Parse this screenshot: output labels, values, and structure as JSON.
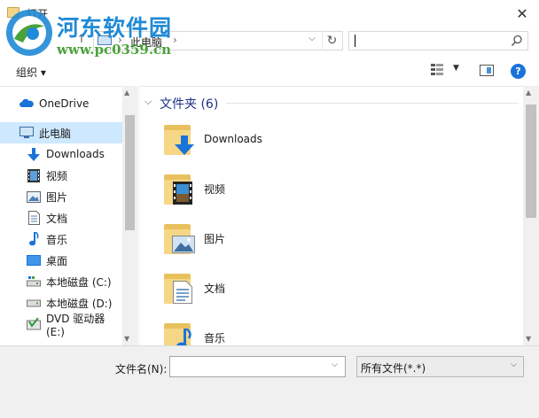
{
  "window": {
    "title": "打开",
    "close_glyph": "✕"
  },
  "watermark": {
    "name": "河东软件园",
    "url": "www.pc0359.cn"
  },
  "address_bar": {
    "up_glyph": "↑",
    "path": [
      "此电脑"
    ],
    "separator": "›",
    "dropdown_glyph": "⌵",
    "refresh_glyph": "↻"
  },
  "search": {
    "value": "",
    "icon": "search-icon"
  },
  "toolbar": {
    "organize_label": "组织 ▾",
    "view_dropdown_glyph": "▼",
    "help_glyph": "?"
  },
  "nav": {
    "items": [
      {
        "label": "OneDrive",
        "icon": "cloud-icon",
        "selected": false
      },
      {
        "label": "此电脑",
        "icon": "computer-icon",
        "selected": true
      },
      {
        "label": "Downloads",
        "icon": "download-icon",
        "selected": false
      },
      {
        "label": "视频",
        "icon": "video-icon",
        "selected": false
      },
      {
        "label": "图片",
        "icon": "picture-icon",
        "selected": false
      },
      {
        "label": "文档",
        "icon": "document-icon",
        "selected": false
      },
      {
        "label": "音乐",
        "icon": "music-icon",
        "selected": false
      },
      {
        "label": "桌面",
        "icon": "desktop-icon",
        "selected": false
      },
      {
        "label": "本地磁盘 (C:)",
        "icon": "drive-icon",
        "selected": false
      },
      {
        "label": "本地磁盘 (D:)",
        "icon": "drive-icon",
        "selected": false
      },
      {
        "label": "DVD 驱动器 (E:)",
        "icon": "dvd-drive-icon",
        "selected": false
      }
    ],
    "scroll_up_glyph": "▲",
    "scroll_down_glyph": "▼"
  },
  "content": {
    "group_title": "文件夹 (6)",
    "group_chevron": "⌵",
    "folders": [
      {
        "label": "Downloads",
        "icon": "download-folder-icon"
      },
      {
        "label": "视频",
        "icon": "video-folder-icon"
      },
      {
        "label": "图片",
        "icon": "picture-folder-icon"
      },
      {
        "label": "文档",
        "icon": "document-folder-icon"
      },
      {
        "label": "音乐",
        "icon": "music-folder-icon"
      }
    ],
    "scroll_up_glyph": "▲",
    "scroll_down_glyph": "▼"
  },
  "bottom": {
    "filename_label": "文件名(N):",
    "filename_value": "",
    "filetype_value": "所有文件(*.*)",
    "dropdown_glyph": "⌵"
  },
  "colors": {
    "selection": "#cde8ff",
    "accent_blue": "#1a73d9",
    "folder_yellow": "#f6d786",
    "group_title": "#1e3287",
    "watermark_blue": "#1f8ad6",
    "watermark_green": "#4aa23a"
  }
}
